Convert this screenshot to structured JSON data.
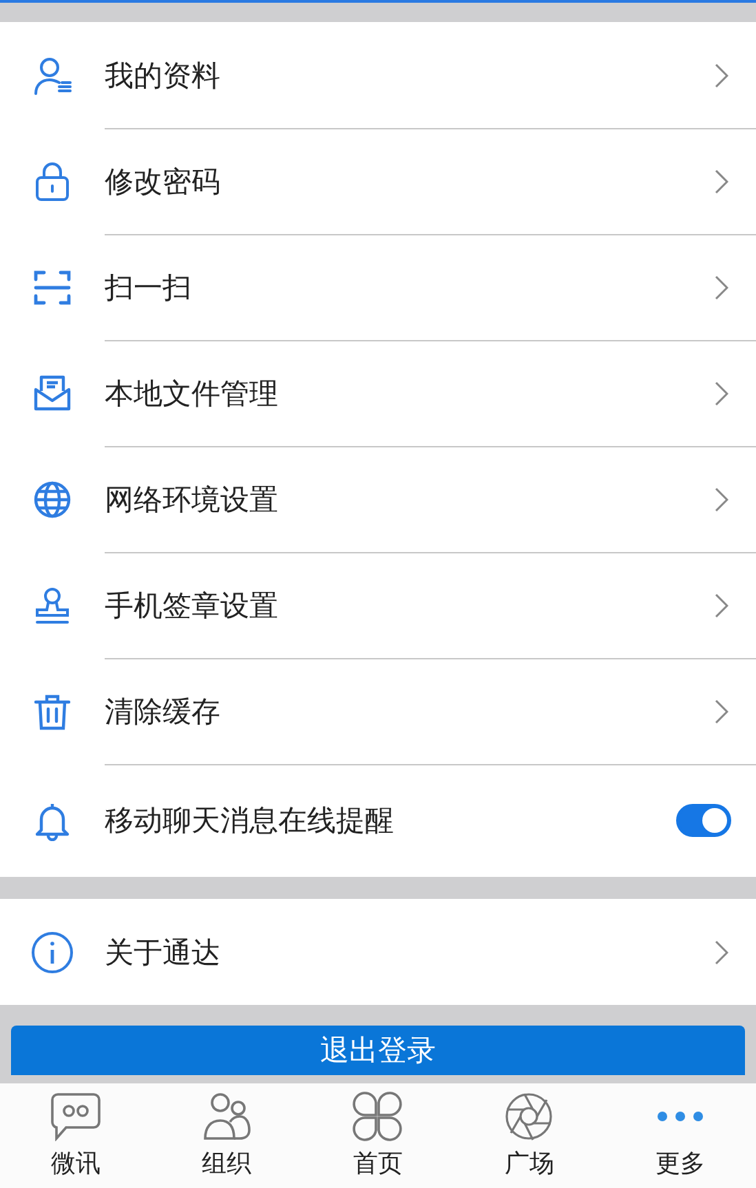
{
  "settings": [
    {
      "kind": "link",
      "label": "我的资料"
    },
    {
      "kind": "link",
      "label": "修改密码"
    },
    {
      "kind": "link",
      "label": "扫一扫"
    },
    {
      "kind": "link",
      "label": "本地文件管理"
    },
    {
      "kind": "link",
      "label": "网络环境设置"
    },
    {
      "kind": "link",
      "label": "手机签章设置"
    },
    {
      "kind": "link",
      "label": "清除缓存"
    },
    {
      "kind": "toggle",
      "label": "移动聊天消息在线提醒",
      "on": true
    }
  ],
  "about": [
    {
      "kind": "link",
      "label": "关于通达"
    }
  ],
  "logout_button": "退出登录",
  "tab_bar": [
    {
      "label": "微讯",
      "selected": false
    },
    {
      "label": "组织",
      "selected": false
    },
    {
      "label": "首页",
      "selected": false
    },
    {
      "label": "广场",
      "selected": false
    },
    {
      "label": "更多",
      "selected": true
    }
  ]
}
